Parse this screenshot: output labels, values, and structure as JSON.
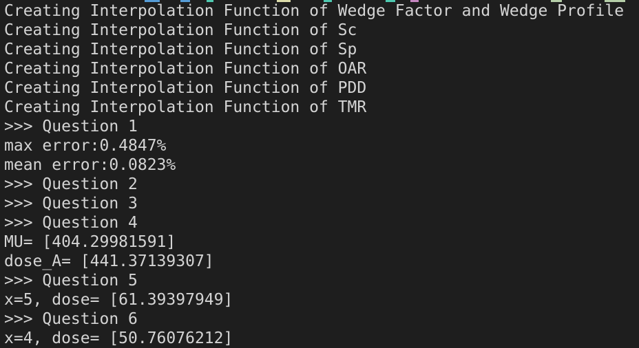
{
  "terminal": {
    "background": "#1e1e1e",
    "text_color": "#d4d4d4",
    "lines": [
      "Creating Interpolation Function of Wedge Factor and Wedge Profile",
      "Creating Interpolation Function of Sc",
      "Creating Interpolation Function of Sp",
      "Creating Interpolation Function of OAR",
      "Creating Interpolation Function of PDD",
      "Creating Interpolation Function of TMR",
      ">>> Question 1",
      "max error:0.4847%",
      "mean error:0.0823%",
      ">>> Question 2",
      ">>> Question 3",
      ">>> Question 4",
      "MU= [404.29981591]",
      "dose_A= [441.37139307]",
      ">>> Question 5",
      "x=5, dose= [61.39397949]",
      ">>> Question 6",
      "x=4, dose= [50.76076212]"
    ]
  }
}
